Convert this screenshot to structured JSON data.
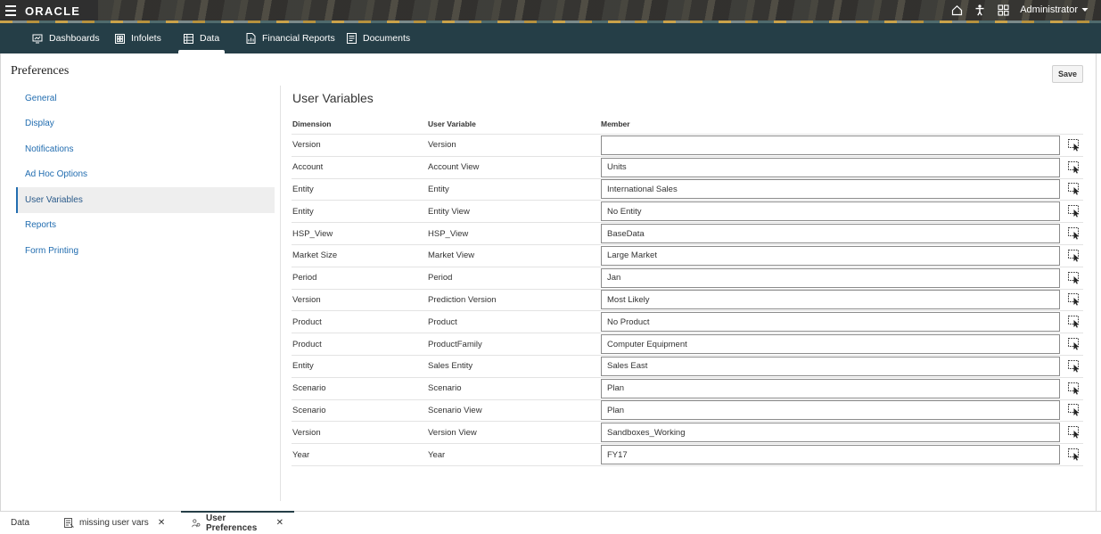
{
  "topbar": {
    "logo": "ORACLE",
    "user": "Administrator",
    "icons": [
      "menu-icon",
      "home-icon",
      "accessibility-icon",
      "navigator-grid-icon",
      "caret-down-icon"
    ]
  },
  "nav": {
    "tabs": [
      {
        "label": "Dashboards",
        "icon": "dashboard-icon"
      },
      {
        "label": "Infolets",
        "icon": "infolets-icon"
      },
      {
        "label": "Data",
        "icon": "data-grid-icon",
        "active": true
      },
      {
        "label": "Financial Reports",
        "icon": "report-icon"
      },
      {
        "label": "Documents",
        "icon": "document-icon"
      }
    ]
  },
  "page": {
    "title": "Preferences",
    "save_label": "Save",
    "section_title": "User Variables"
  },
  "sidebar": {
    "items": [
      {
        "label": "General"
      },
      {
        "label": "Display"
      },
      {
        "label": "Notifications"
      },
      {
        "label": "Ad Hoc Options"
      },
      {
        "label": "User Variables",
        "active": true
      },
      {
        "label": "Reports"
      },
      {
        "label": "Form Printing"
      }
    ]
  },
  "grid": {
    "headers": {
      "dimension": "Dimension",
      "user_variable": "User Variable",
      "member": "Member"
    },
    "rows": [
      {
        "dimension": "Version",
        "user_variable": "Version",
        "member": ""
      },
      {
        "dimension": "Account",
        "user_variable": "Account View",
        "member": "Units"
      },
      {
        "dimension": "Entity",
        "user_variable": "Entity",
        "member": "International Sales"
      },
      {
        "dimension": "Entity",
        "user_variable": "Entity View",
        "member": "No Entity"
      },
      {
        "dimension": "HSP_View",
        "user_variable": "HSP_View",
        "member": "BaseData"
      },
      {
        "dimension": "Market Size",
        "user_variable": "Market View",
        "member": "Large Market"
      },
      {
        "dimension": "Period",
        "user_variable": "Period",
        "member": "Jan"
      },
      {
        "dimension": "Version",
        "user_variable": "Prediction Version",
        "member": "Most Likely"
      },
      {
        "dimension": "Product",
        "user_variable": "Product",
        "member": "No Product"
      },
      {
        "dimension": "Product",
        "user_variable": "ProductFamily",
        "member": "Computer Equipment"
      },
      {
        "dimension": "Entity",
        "user_variable": "Sales Entity",
        "member": "Sales East"
      },
      {
        "dimension": "Scenario",
        "user_variable": "Scenario",
        "member": "Plan"
      },
      {
        "dimension": "Scenario",
        "user_variable": "Scenario View",
        "member": "Plan"
      },
      {
        "dimension": "Version",
        "user_variable": "Version View",
        "member": "Sandboxes_Working"
      },
      {
        "dimension": "Year",
        "user_variable": "Year",
        "member": "FY17"
      }
    ]
  },
  "bottom_tabs": [
    {
      "label": "Data"
    },
    {
      "label": "missing user vars",
      "closable": true,
      "icon": "form-icon"
    },
    {
      "label": "User Preferences",
      "closable": true,
      "active": true,
      "icon": "user-preferences-icon"
    }
  ],
  "close_glyph": "✕",
  "colors": {
    "topbar": "#2f2f2f",
    "navbar": "#253e47",
    "link": "#226db0",
    "active_side_bg": "#eeeeee"
  }
}
